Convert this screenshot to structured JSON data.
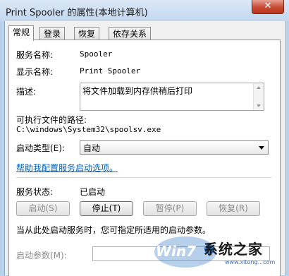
{
  "window": {
    "title": "Print Spooler 的属性(本地计算机)",
    "close_glyph": "✕"
  },
  "tabs": [
    {
      "label": "常规",
      "active": true
    },
    {
      "label": "登录",
      "active": false
    },
    {
      "label": "恢复",
      "active": false
    },
    {
      "label": "依存关系",
      "active": false
    }
  ],
  "general": {
    "service_name_label": "服务名称:",
    "service_name": "Spooler",
    "display_name_label": "显示名称:",
    "display_name": "Print Spooler",
    "description_label": "描述:",
    "description": "将文件加载到内存供稍后打印",
    "exe_path_label": "可执行文件的路径:",
    "exe_path": "C:\\windows\\System32\\spoolsv.exe",
    "startup_type_label": "启动类型(E):",
    "startup_type": "自动",
    "help_link": "帮助我配置服务启动选项。",
    "status_label": "服务状态:",
    "status": "已启动",
    "buttons": {
      "start": "启动(S)",
      "stop": "停止(T)",
      "pause": "暂停(P)",
      "resume": "恢复(R)"
    },
    "hint": "当从此处启动服务时，您可指定所适用的启动参数。",
    "params_label": "启动参数(M):",
    "params_value": ""
  },
  "watermark": {
    "logo_text": "系统之家",
    "brand": "Win7",
    "url": "www.xitong...com"
  },
  "colors": {
    "accent_link": "#0060c0",
    "close_button": "#c74a34"
  }
}
